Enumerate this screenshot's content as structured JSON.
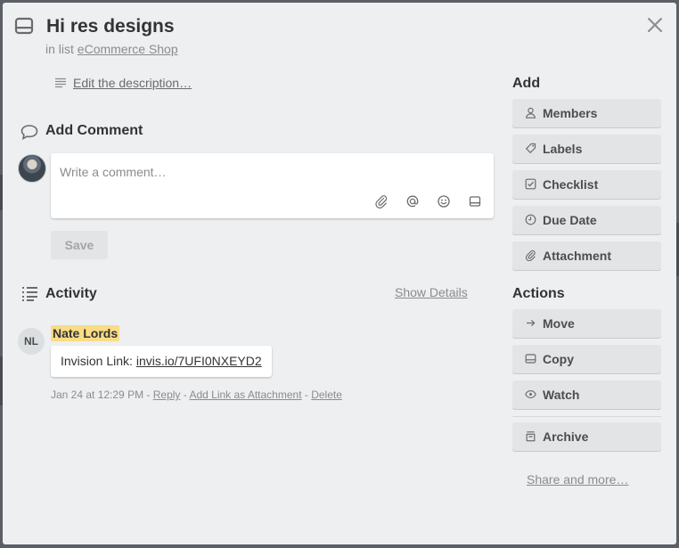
{
  "card": {
    "title": "Hi res designs",
    "in_list_prefix": "in list",
    "list_name": "eCommerce Shop",
    "edit_description": "Edit the description…"
  },
  "comment": {
    "heading": "Add Comment",
    "placeholder": "Write a comment…",
    "save_label": "Save"
  },
  "activity": {
    "heading": "Activity",
    "show_details": "Show Details",
    "entries": [
      {
        "initials": "NL",
        "member": "Nate Lords",
        "text_prefix": "Invision Link:",
        "link": "invis.io/7UFI0NXEYD2",
        "timestamp": "Jan 24 at 12:29 PM",
        "reply": "Reply",
        "add_link": "Add Link as Attachment",
        "delete": "Delete"
      }
    ]
  },
  "sidebar": {
    "add_heading": "Add",
    "add_items": [
      {
        "label": "Members",
        "icon": "person-icon"
      },
      {
        "label": "Labels",
        "icon": "tag-icon"
      },
      {
        "label": "Checklist",
        "icon": "checkbox-icon"
      },
      {
        "label": "Due Date",
        "icon": "clock-icon"
      },
      {
        "label": "Attachment",
        "icon": "paperclip-icon"
      }
    ],
    "actions_heading": "Actions",
    "action_items": [
      {
        "label": "Move",
        "icon": "arrow-right-icon"
      },
      {
        "label": "Copy",
        "icon": "card-icon"
      },
      {
        "label": "Watch",
        "icon": "eye-icon"
      },
      {
        "label": "Archive",
        "icon": "archive-icon"
      }
    ],
    "share": "Share and more…"
  },
  "colors": {
    "modal_bg": "#edeff0",
    "button_bg": "#e2e4e6",
    "highlight": "#f9dc85",
    "text_dark": "#333333",
    "text_muted": "#8c8c8c"
  }
}
